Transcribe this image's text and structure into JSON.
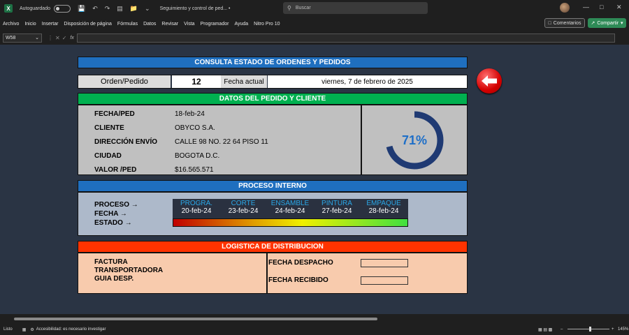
{
  "titlebar": {
    "autosave_label": "Autoguardado",
    "doc_title": "Seguimiento y control de ped... •",
    "search_placeholder": "Buscar"
  },
  "ribbon": {
    "tabs": [
      "Archivo",
      "Inicio",
      "Insertar",
      "Disposición de página",
      "Fórmulas",
      "Datos",
      "Revisar",
      "Vista",
      "Programador",
      "Ayuda",
      "Nitro Pro 10"
    ],
    "comments_label": "Comentarios",
    "share_label": "Compartir"
  },
  "formulabar": {
    "name_box": "W58",
    "fx": "fx"
  },
  "sheet": {
    "title": "CONSULTA ESTADO DE ORDENES Y PEDIDOS",
    "order_label": "Orden/Pedido",
    "order_value": "12",
    "date_label": "Fecha actual",
    "date_value": "viernes, 7 de febrero de 2025",
    "client_section_title": "DATOS DEL PEDIDO Y CLIENTE",
    "fields": [
      {
        "label": "FECHA/PED",
        "value": "18-feb-24"
      },
      {
        "label": "CLIENTE",
        "value": "OBYCO S.A."
      },
      {
        "label": "DIRECCIÓN ENVÍO",
        "value": "CALLE 98 NO. 22 64 PISO 11"
      },
      {
        "label": "CIUDAD",
        "value": "BOGOTA D.C."
      },
      {
        "label": "VALOR /PED",
        "value": "$16.565.571"
      }
    ],
    "progress_percent": 71,
    "progress_label": "71%",
    "process_section_title": "PROCESO INTERNO",
    "process_labels": [
      "PROCESO →",
      "FECHA →",
      "ESTADO →"
    ],
    "stages": [
      {
        "name": "PROGRA.",
        "date": "20-feb-24"
      },
      {
        "name": "CORTE",
        "date": "23-feb-24"
      },
      {
        "name": "ENSAMBLE",
        "date": "24-feb-24"
      },
      {
        "name": "PINTURA",
        "date": "27-feb-24"
      },
      {
        "name": "EMPAQUE",
        "date": "28-feb-24"
      }
    ],
    "logistics_section_title": "LOGISTICA DE DISTRIBUCION",
    "logistics_left": [
      "FACTURA",
      "TRANSPORTADORA",
      "GUIA DESP."
    ],
    "dispatch_label": "FECHA DESPACHO",
    "received_label": "FECHA RECIBIDO"
  },
  "status": {
    "ready": "Listo",
    "accessibility": "Accesibilidad: es necesario investigar",
    "zoom": "145%"
  },
  "colors": {
    "banner_blue": "#1f6fbf",
    "banner_green": "#00b050",
    "banner_red": "#ff3300",
    "panel_gray": "#c0c0c0",
    "panel_lightblue": "#adb9ca",
    "panel_peach": "#f8cbad",
    "donut": "#1f3a73"
  }
}
